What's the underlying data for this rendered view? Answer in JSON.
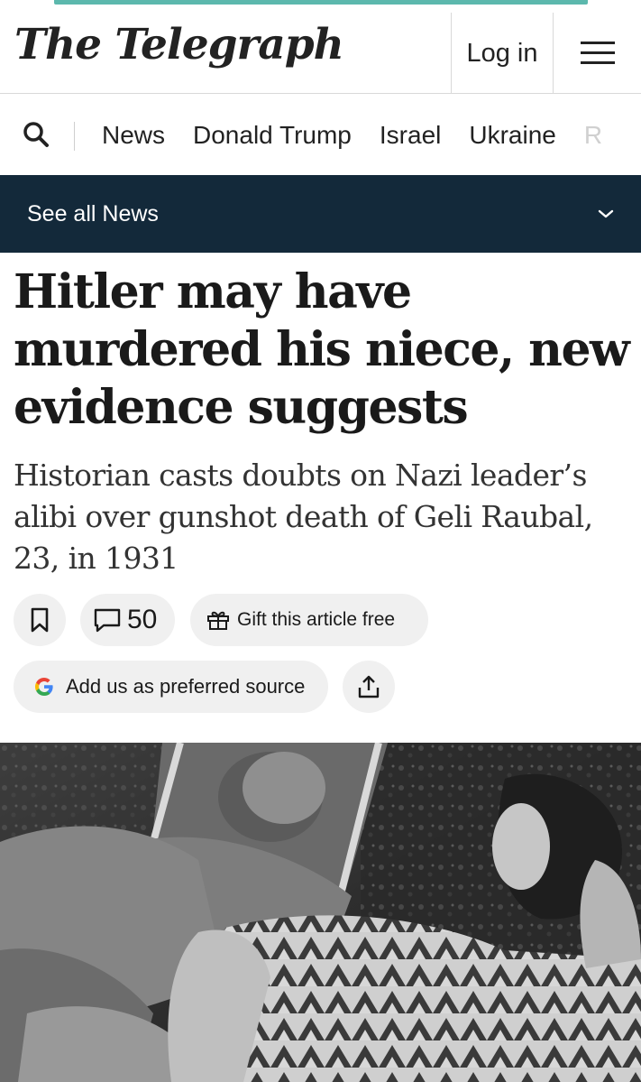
{
  "masthead": {
    "logo": "The Telegraph",
    "login_label": "Log in"
  },
  "nav": {
    "items": [
      "News",
      "Donald Trump",
      "Israel",
      "Ukraine",
      "R"
    ]
  },
  "subnav": {
    "label": "See all News"
  },
  "article": {
    "headline": "Hitler may have murdered his niece, new evidence suggests",
    "standfirst": "Historian casts doubts on Nazi leader’s alibi over gunshot death of Geli Raubal, 23, in 1931",
    "comment_count": "50",
    "gift_label": "Gift this article free",
    "source_label": "Add us as preferred source"
  },
  "icons": {
    "search": "search-icon",
    "menu": "hamburger-menu-icon",
    "chevron": "chevron-down-icon",
    "bookmark": "bookmark-icon",
    "comment": "comment-icon",
    "gift": "gift-icon",
    "google": "google-g-icon",
    "share": "share-icon"
  },
  "colors": {
    "accent": "#5cb8ad",
    "subnav_bg": "#13293a",
    "pill_bg": "#f0f0f0"
  }
}
